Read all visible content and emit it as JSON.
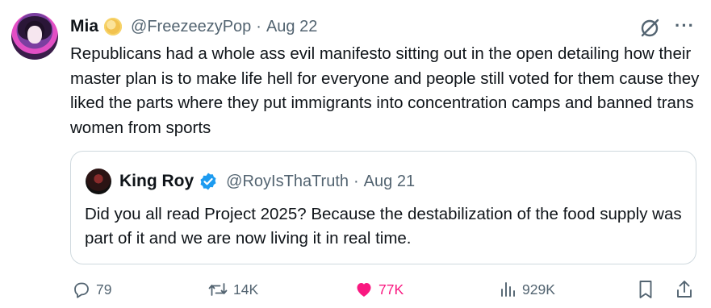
{
  "author": {
    "name": "Mia",
    "handle": "@FreezeezyPop",
    "separator": "·",
    "date": "Aug 22",
    "badge_icon": "gold-coin-badge",
    "more_label": "···"
  },
  "tweet": {
    "text": "Republicans had a whole ass evil manifesto sitting out in the open detailing how their master plan is to make life hell for everyone and people still voted for them cause they liked the parts where they put immigrants into concentration camps and banned trans women from sports"
  },
  "quote": {
    "name": "King Roy",
    "handle": "@RoyIsThaTruth",
    "separator": "·",
    "date": "Aug 21",
    "badge_icon": "verified-check-icon",
    "text": "Did you all read Project 2025? Because the destabilization of the food supply was part of it and we are now living it in real time."
  },
  "actions": {
    "replies": "79",
    "retweets": "14K",
    "likes": "77K",
    "views": "929K"
  },
  "colors": {
    "muted": "#536471",
    "text": "#0f1419",
    "like": "#f91880",
    "verified": "#1d9bf0",
    "border": "#cfd9de"
  }
}
